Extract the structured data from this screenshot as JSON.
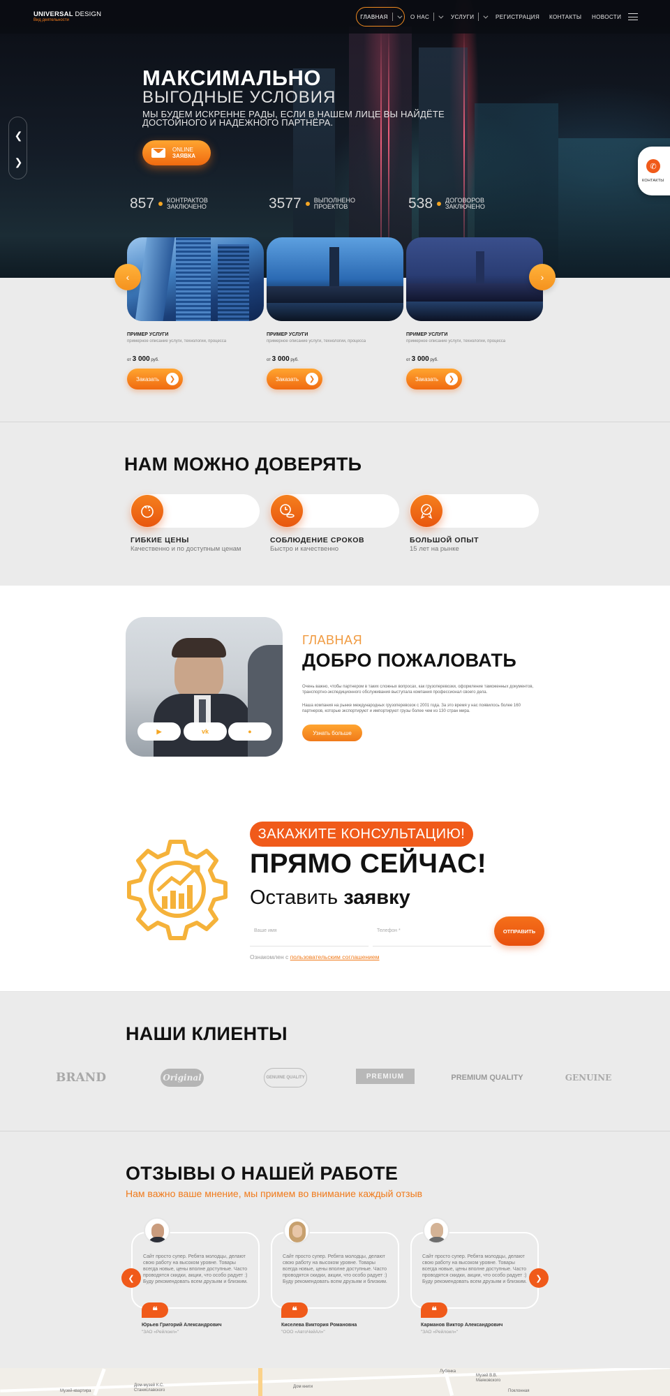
{
  "header": {
    "logo_main": "UNIVERSAL",
    "logo_main2": "DESIGN",
    "logo_sub": "Вид деятельности",
    "nav": [
      "ГЛАВНАЯ",
      "О НАС",
      "УСЛУГИ",
      "РЕГИСТРАЦИЯ",
      "КОНТАКТЫ",
      "НОВОСТИ"
    ]
  },
  "hero": {
    "title": "МАКСИМАЛЬНО",
    "subtitle": "ВЫГОДНЫЕ УСЛОВИЯ",
    "desc": "МЫ БУДЕМ ИСКРЕННЕ РАДЫ, ЕСЛИ В НАШЕМ ЛИЦЕ ВЫ НАЙДЁТЕ ДОСТОЙНОГО И НАДЕЖНОГО ПАРТНЁРА.",
    "cta_line1": "ONLINE",
    "cta_line2": "ЗАЯВКА",
    "stats": [
      {
        "num": "857",
        "l1": "КОНТРАКТОВ",
        "l2": "ЗАКЛЮЧЕНО"
      },
      {
        "num": "3577",
        "l1": "ВЫПОЛНЕНО",
        "l2": "ПРОЕКТОВ"
      },
      {
        "num": "538",
        "l1": "ДОГОВОРОВ",
        "l2": "ЗАКЛЮЧЕНО"
      }
    ],
    "contact_tab": "КОНТАКТЫ"
  },
  "services": [
    {
      "title": "ПРИМЕР УСЛУГИ",
      "desc": "примерное описание услуги, технологии, процесса",
      "price_prefix": "от",
      "price": "3 000",
      "price_unit": "руб.",
      "button": "Заказать"
    },
    {
      "title": "ПРИМЕР УСЛУГИ",
      "desc": "примерное описание услуги, технологии, процесса",
      "price_prefix": "от",
      "price": "3 000",
      "price_unit": "руб.",
      "button": "Заказать"
    },
    {
      "title": "ПРИМЕР УСЛУГИ",
      "desc": "примерное описание услуги, технологии, процесса",
      "price_prefix": "от",
      "price": "3 000",
      "price_unit": "руб.",
      "button": "Заказать"
    }
  ],
  "trust": {
    "title": "НАМ МОЖНО ДОВЕРЯТЬ",
    "items": [
      {
        "title": "ГИБКИЕ ЦЕНЫ",
        "sub": "Качественно и по доступным ценам",
        "icon": "piggy-icon"
      },
      {
        "title": "СОБЛЮДЕНИЕ СРОКОВ",
        "sub": "Быстро и качественно",
        "icon": "clock-coins-icon"
      },
      {
        "title": "БОЛЬШОЙ ОПЫТ",
        "sub": "15 лет на рынке",
        "icon": "award-icon"
      }
    ]
  },
  "welcome": {
    "kicker": "ГЛАВНАЯ",
    "title": "ДОБРО ПОЖАЛОВАТЬ",
    "p1": "Очень важно, чтобы партнером в таких сложных вопросах, как грузоперевозки, оформление таможенных документов, транспортно-экспедиционного обслуживания выступала компания профессионал своего дела.",
    "p2": "Наша компания на рынке международных грузоперевозок с 2001 года. За это время у нас появилось более 160 партнеров, которые экспортируют и импортируют грузы более чем из 130 стран мира.",
    "button": "Узнать больше"
  },
  "consult": {
    "pill": "ЗАКАЖИТЕ КОНСУЛЬТАЦИЮ!",
    "title": "ПРЯМО СЕЙЧАС!",
    "sub1": "Оставить",
    "sub2": "заявку",
    "name_placeholder": "Ваше имя",
    "phone_placeholder": "Телефон *",
    "send": "ОТПРАВИТЬ",
    "agree_prefix": "Ознакомлен с",
    "agree_link": "пользовательским соглашением"
  },
  "clients": {
    "title": "НАШИ КЛИЕНТЫ",
    "logos": [
      "BRAND",
      "Original",
      "GENUINE QUALITY",
      "PREMIUM",
      "PREMIUM QUALITY",
      "GENUINE"
    ]
  },
  "reviews": {
    "title": "ОТЗЫВЫ О НАШЕЙ РАБОТЕ",
    "sub": "Нам важно ваше мнение, мы примем во внимание каждый отзыв",
    "items": [
      {
        "text": "Сайт просто супер. Ребята молодцы, делают свою работу на высоком уровне. Товары всегда новые, цены вполне доступные. Часто проводятся скидки, акции, что особо радует :) Буду рекомендовать всем друзьям и близким.",
        "name": "Юрьев Григорий Александрович",
        "org": "\"ЗАО «Рейлоил»\""
      },
      {
        "text": "Сайт просто супер. Ребята молодцы, делают свою работу на высоком уровне. Товары всегда новые, цены вполне доступные. Часто проводятся скидки, акции, что особо радует :) Буду рекомендовать всем друзьям и близким.",
        "name": "Киселева Виктория Романовна",
        "org": "\"ООО «АвтоЧейАл»\""
      },
      {
        "text": "Сайт просто супер. Ребята молодцы, делают свою работу на высоком уровне. Товары всегда новые, цены вполне доступные. Часто проводятся скидки, акции, что особо радует :) Буду рекомендовать всем друзьям и близким.",
        "name": "Карманов Виктор Александрович",
        "org": "\"ЗАО «Рейлоил»\""
      }
    ]
  },
  "map": {
    "labels": [
      "Музей-квартира",
      "Дом-музей К.С. Станиславского",
      "Дом книги",
      "Музей В.В. Маяковского",
      "Лубянка",
      "Поклонная"
    ]
  },
  "colors": {
    "accent": "#f07a1a",
    "accent_dark": "#e8500e",
    "yellow": "#f5a623"
  }
}
